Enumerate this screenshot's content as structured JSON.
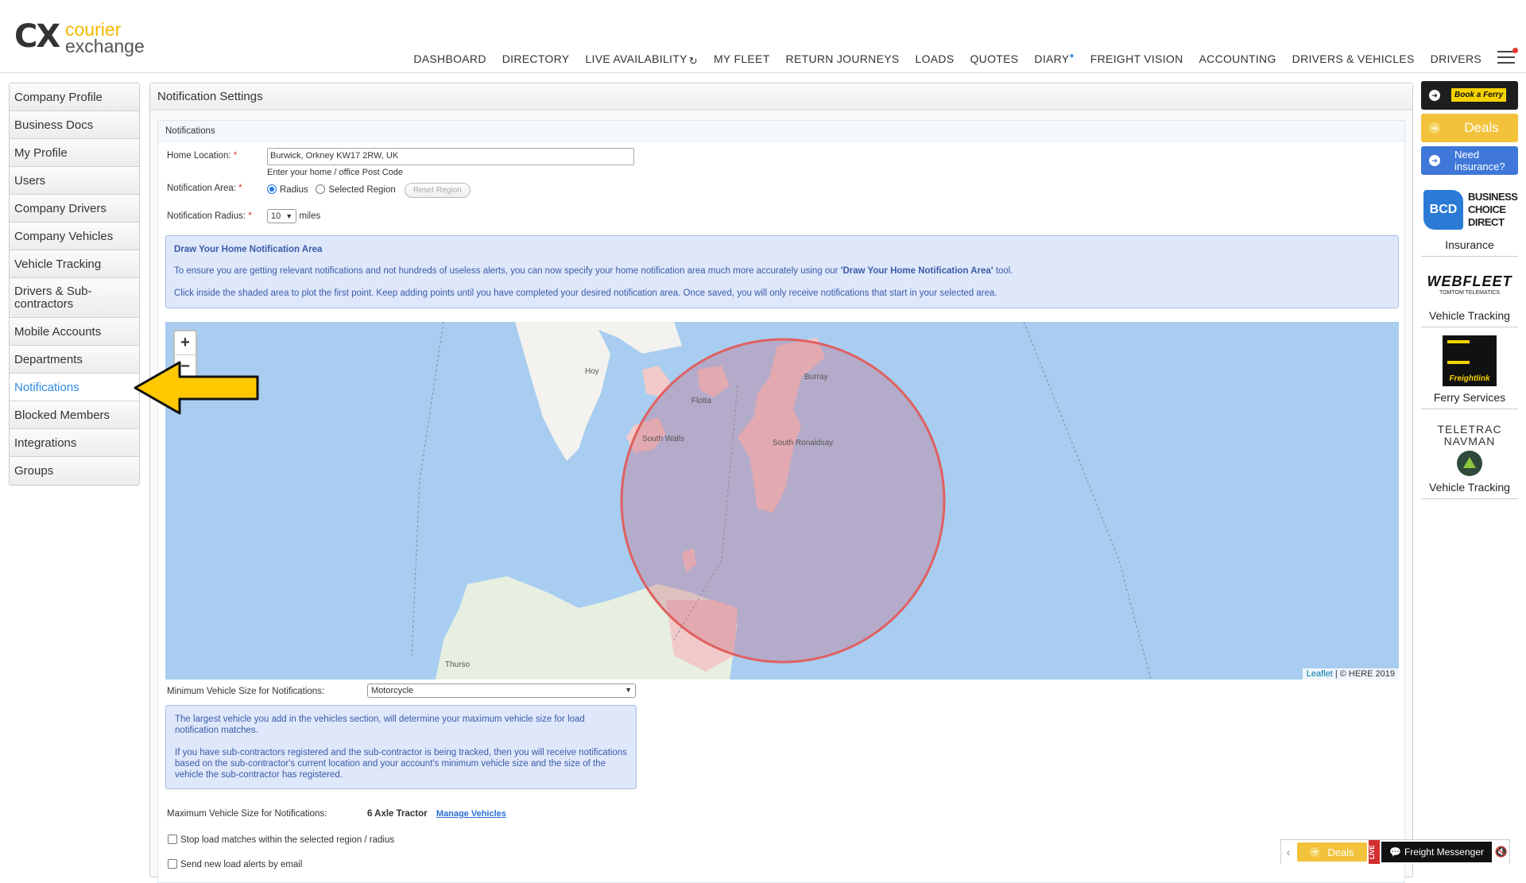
{
  "logo": {
    "mark": "CX",
    "word1": "courier",
    "word2": "exchange"
  },
  "nav": [
    {
      "label": "DASHBOARD"
    },
    {
      "label": "DIRECTORY"
    },
    {
      "label": "LIVE AVAILABILITY"
    },
    {
      "label": "MY FLEET"
    },
    {
      "label": "RETURN JOURNEYS"
    },
    {
      "label": "LOADS"
    },
    {
      "label": "QUOTES"
    },
    {
      "label": "DIARY"
    },
    {
      "label": "FREIGHT VISION"
    },
    {
      "label": "ACCOUNTING"
    },
    {
      "label": "DRIVERS & VEHICLES"
    },
    {
      "label": "DRIVERS"
    }
  ],
  "sidebar": {
    "items": [
      {
        "label": "Company Profile"
      },
      {
        "label": "Business Docs"
      },
      {
        "label": "My Profile"
      },
      {
        "label": "Users"
      },
      {
        "label": "Company Drivers"
      },
      {
        "label": "Company Vehicles"
      },
      {
        "label": "Vehicle Tracking"
      },
      {
        "label": "Drivers & Sub-contractors"
      },
      {
        "label": "Mobile Accounts"
      },
      {
        "label": "Departments"
      },
      {
        "label": "Notifications"
      },
      {
        "label": "Blocked Members"
      },
      {
        "label": "Integrations"
      },
      {
        "label": "Groups"
      }
    ],
    "active": "Notifications"
  },
  "main": {
    "title": "Notification Settings",
    "panel_title": "Notifications",
    "home_location": {
      "label": "Home Location:",
      "value": "Burwick, Orkney KW17 2RW, UK",
      "hint": "Enter your home / office Post Code"
    },
    "notification_area": {
      "label": "Notification Area:",
      "radius_label": "Radius",
      "region_label": "Selected Region",
      "reset_label": "Reset Region",
      "selected": "Radius"
    },
    "notification_radius": {
      "label": "Notification Radius:",
      "value": "10",
      "unit": "miles"
    },
    "draw_box": {
      "title": "Draw Your Home Notification Area",
      "p1_pre": "To ensure you are getting relevant notifications and not hundreds of useless alerts, you can now specify your home notification area much more accurately using our ",
      "p1_bold": "'Draw Your Home Notification Area'",
      "p1_post": " tool.",
      "p2": "Click inside the shaded area to plot the first point. Keep adding points until you have completed your desired notification area. Once saved, you will only receive notifications that start in your selected area."
    },
    "map": {
      "zoom_in": "+",
      "zoom_out": "−",
      "places": [
        "Hoy",
        "Burray",
        "Flotta",
        "South Walls",
        "South Ronaldsay",
        "Thurso"
      ],
      "attribution_link": "Leaflet",
      "attribution_text": " | © HERE 2019",
      "circle_color": "#e06060"
    },
    "min_vehicle": {
      "label": "Minimum Vehicle Size for Notifications:",
      "value": "Motorcycle"
    },
    "vehicle_box": {
      "p1": "The largest vehicle you add in the vehicles section, will determine your maximum vehicle size for load notification matches.",
      "p2": "If you have sub-contractors registered and the sub-contractor is being tracked, then you will receive notifications based on the sub-contractor's current location and your account's minimum vehicle size and the size of the vehicle the sub-contractor has registered."
    },
    "max_vehicle": {
      "label": "Maximum Vehicle Size for Notifications:",
      "value": "6 Axle Tractor",
      "link": "Manage Vehicles"
    },
    "stop_matches": {
      "label": "Stop load matches within the selected region / radius"
    },
    "send_email": {
      "label": "Send new load alerts by email"
    }
  },
  "ads": {
    "ferry": "Book a Ferry",
    "deals": "Deals",
    "insurance": "Need insurance?",
    "bcd_box": "BCD",
    "bcd_text": "BUSINESS CHOICE DIRECT",
    "bcd_caption": "Insurance",
    "webfleet": "WEBFLEET",
    "webfleet_sub": "TOMTOM TELEMATICS",
    "webfleet_caption": "Vehicle Tracking",
    "freightlink": "Freightlink",
    "freightlink_caption": "Ferry Services",
    "teletrac": "TELETRAC NAVMAN",
    "teletrac_caption": "Vehicle Tracking"
  },
  "bottom_bar": {
    "deals": "Deals",
    "live": "LIVE",
    "messenger": "Freight Messenger"
  },
  "colors": {
    "accent": "#2f8de4",
    "brand_yellow": "#f5b800",
    "info_bg": "#dfe7fa"
  }
}
